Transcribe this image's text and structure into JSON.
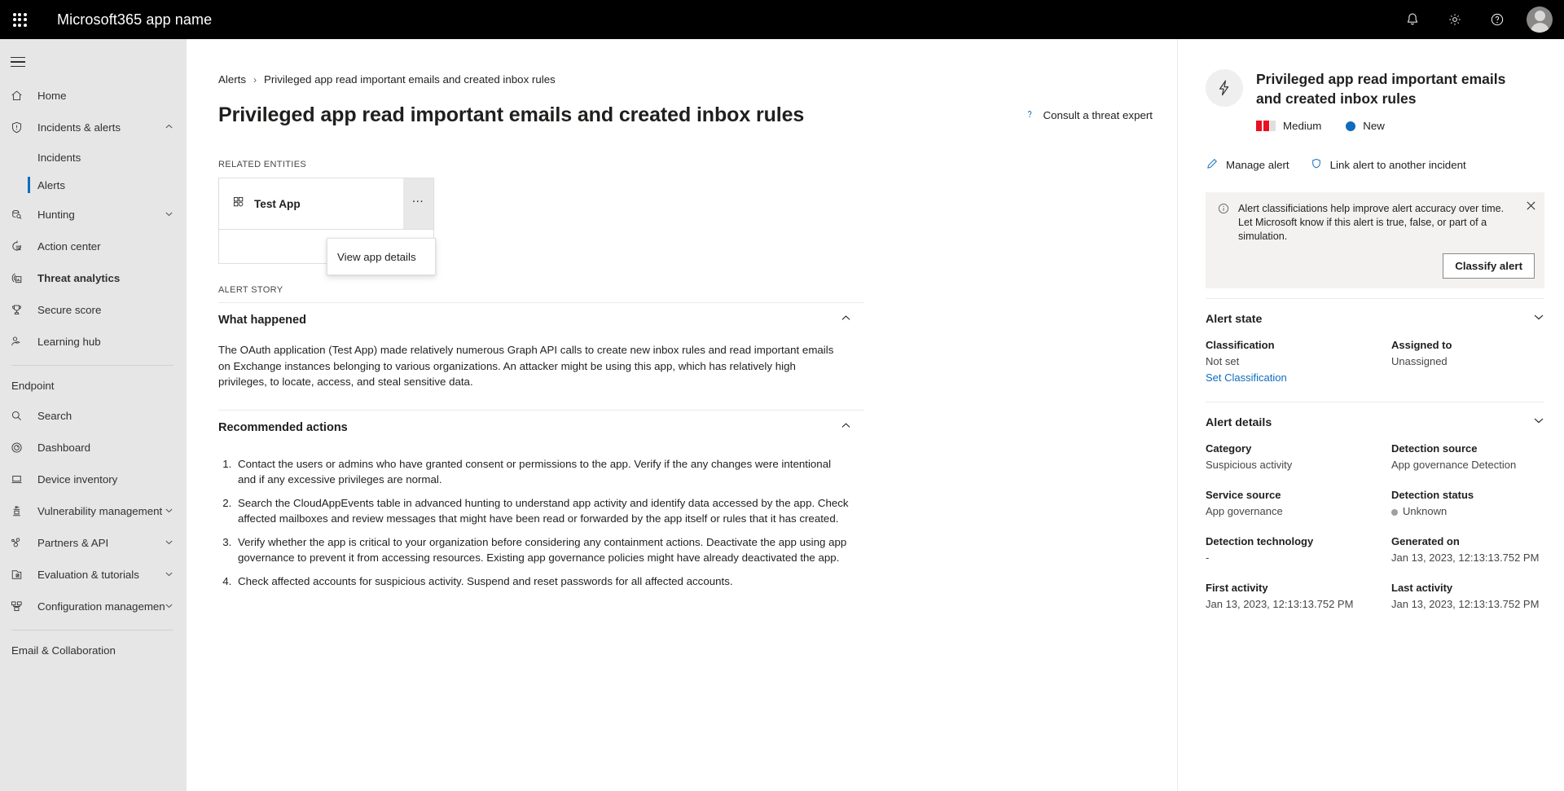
{
  "suitebar": {
    "waffle_label": "app-launcher",
    "title": "Microsoft365 app name",
    "notifications_label": "Notifications",
    "settings_label": "Settings",
    "help_label": "Help",
    "account_label": "Account manager"
  },
  "sidebar": {
    "hamburger_label": "Collapse navigation",
    "items": [
      {
        "label": "Home",
        "icon": "home-icon",
        "expandable": false
      },
      {
        "label": "Incidents & alerts",
        "icon": "shield-alert-icon",
        "expandable": true,
        "expanded": true
      },
      {
        "label": "Hunting",
        "icon": "hunting-icon",
        "expandable": true
      },
      {
        "label": "Action center",
        "icon": "action-center-icon",
        "expandable": false
      },
      {
        "label": "Threat analytics",
        "icon": "threat-analytics-icon",
        "expandable": false,
        "bold": true
      },
      {
        "label": "Secure score",
        "icon": "trophy-icon",
        "expandable": false
      },
      {
        "label": "Learning hub",
        "icon": "learning-hub-icon",
        "expandable": false
      }
    ],
    "children": [
      {
        "label": "Incidents",
        "selected": false
      },
      {
        "label": "Alerts",
        "selected": true
      }
    ],
    "endpoint_section": "Endpoint",
    "endpoint_items": [
      {
        "label": "Search",
        "icon": "search-icon",
        "expandable": false
      },
      {
        "label": "Dashboard",
        "icon": "dashboard-icon",
        "expandable": false
      },
      {
        "label": "Device inventory",
        "icon": "device-icon",
        "expandable": false
      },
      {
        "label": "Vulnerability management",
        "icon": "vulnerability-icon",
        "expandable": true
      },
      {
        "label": "Partners & API",
        "icon": "partners-api-icon",
        "expandable": true
      },
      {
        "label": "Evaluation & tutorials",
        "icon": "evaluation-icon",
        "expandable": true
      },
      {
        "label": "Configuration management",
        "icon": "configuration-icon",
        "expandable": true
      }
    ],
    "email_section": "Email & Collaboration"
  },
  "breadcrumb": {
    "root": "Alerts",
    "separator": "›",
    "current": "Privileged app read important emails and created inbox rules"
  },
  "page": {
    "title": "Privileged app read important emails and created inbox rules",
    "consult_label": "Consult a threat expert",
    "consult_icon": "question-mark-icon"
  },
  "related_entities": {
    "caption": "RELATED ENTITIES",
    "entity_name": "Test App",
    "entity_icon": "app-icon",
    "more_label": "…",
    "menu": {
      "items": [
        {
          "label": "View app details"
        }
      ]
    }
  },
  "alert_story": {
    "caption": "ALERT STORY",
    "sections": [
      {
        "title": "What happened",
        "expanded": true,
        "body": "The OAuth application (Test App) made relatively numerous Graph API calls to create new inbox rules and read important emails on Exchange instances belonging to various organizations. An attacker might be using this app, which has relatively high privileges, to locate, access, and steal sensitive data."
      },
      {
        "title": "Recommended actions",
        "expanded": true,
        "items": [
          "Contact the users or admins who have granted consent or permissions to the app. Verify if the any changes were intentional and if any excessive privileges are normal.",
          "Search the CloudAppEvents table in advanced hunting to understand app activity and identify data accessed by the app. Check affected mailboxes and review messages that might have been read or forwarded by the app itself or rules that it has created.",
          "Verify whether the app is critical to your organization before considering any containment actions. Deactivate the app using app governance to prevent it from accessing resources. Existing app governance policies might have already deactivated the app.",
          "Check affected accounts for suspicious activity. Suspend and reset passwords for all affected accounts."
        ]
      }
    ]
  },
  "detail_panel": {
    "icon": "lightning-bolt-icon",
    "title": "Privileged app read important emails and created inbox rules",
    "severity": {
      "label": "Medium",
      "color": "#e81123",
      "filled_bars": 2,
      "total_bars": 3
    },
    "status": {
      "label": "New",
      "color": "#0f6cbd"
    },
    "actions": [
      {
        "label": "Manage alert",
        "icon": "pencil-icon"
      },
      {
        "label": "Link alert to another incident",
        "icon": "shield-icon"
      }
    ],
    "banner": {
      "icon": "info-icon",
      "text": "Alert classificiations help improve alert accuracy over time. Let Microsoft know if this alert is true, false, or part of a simulation.",
      "button": "Classify alert",
      "close_label": "Close"
    },
    "alert_state": {
      "title": "Alert state",
      "fields": [
        {
          "key": "Classification",
          "value": "Not set",
          "link": "Set Classification"
        },
        {
          "key": "Assigned to",
          "value": "Unassigned"
        }
      ]
    },
    "alert_details": {
      "title": "Alert details",
      "fields": [
        {
          "key": "Category",
          "value": "Suspicious activity"
        },
        {
          "key": "Detection source",
          "value": "App governance Detection"
        },
        {
          "key": "Service source",
          "value": "App governance"
        },
        {
          "key": "Detection status",
          "value": "Unknown",
          "dot": true
        },
        {
          "key": "Detection technology",
          "value": "-"
        },
        {
          "key": "Generated on",
          "value": "Jan 13, 2023, 12:13:13.752 PM"
        },
        {
          "key": "First activity",
          "value": "Jan 13, 2023, 12:13:13.752 PM"
        },
        {
          "key": "Last activity",
          "value": "Jan 13, 2023, 12:13:13.752 PM"
        }
      ]
    }
  }
}
